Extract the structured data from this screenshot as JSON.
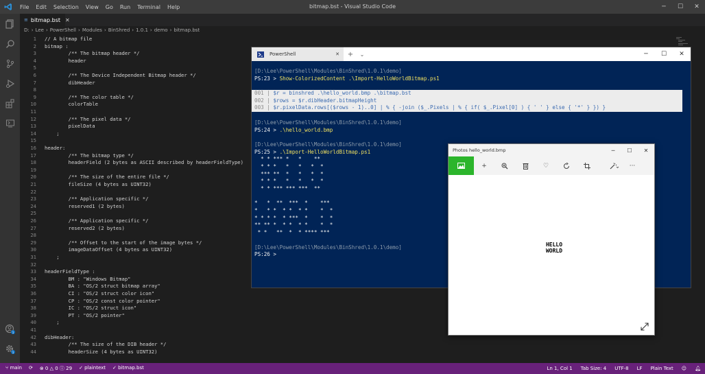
{
  "window": {
    "title": "bitmap.bst - Visual Studio Code"
  },
  "menu": [
    "File",
    "Edit",
    "Selection",
    "View",
    "Go",
    "Run",
    "Terminal",
    "Help"
  ],
  "tab": {
    "label": "bitmap.bst"
  },
  "breadcrumb": [
    "D:",
    "Lee",
    "PowerShell",
    "Modules",
    "BinShred",
    "1.0.1",
    "demo",
    "bitmap.bst"
  ],
  "code_lines": [
    {
      "n": "1",
      "t": "// A bitmap file"
    },
    {
      "n": "2",
      "t": "bitmap :"
    },
    {
      "n": "3",
      "t": "        /** The bitmap header */"
    },
    {
      "n": "4",
      "t": "        header"
    },
    {
      "n": "5",
      "t": ""
    },
    {
      "n": "6",
      "t": "        /** The Device Independent Bitmap header */"
    },
    {
      "n": "7",
      "t": "        dibHeader"
    },
    {
      "n": "8",
      "t": ""
    },
    {
      "n": "9",
      "t": "        /** The color table */"
    },
    {
      "n": "10",
      "t": "        colorTable"
    },
    {
      "n": "11",
      "t": ""
    },
    {
      "n": "12",
      "t": "        /** The pixel data */"
    },
    {
      "n": "13",
      "t": "        pixelData"
    },
    {
      "n": "14",
      "t": "    ;"
    },
    {
      "n": "15",
      "t": ""
    },
    {
      "n": "16",
      "t": "header:"
    },
    {
      "n": "17",
      "t": "        /** The bitmap type */"
    },
    {
      "n": "18",
      "t": "        headerField (2 bytes as ASCII described by headerFieldType)"
    },
    {
      "n": "19",
      "t": ""
    },
    {
      "n": "20",
      "t": "        /** The size of the entire file */"
    },
    {
      "n": "21",
      "t": "        fileSize (4 bytes as UINT32)"
    },
    {
      "n": "22",
      "t": ""
    },
    {
      "n": "23",
      "t": "        /** Application specific */"
    },
    {
      "n": "24",
      "t": "        reserved1 (2 bytes)"
    },
    {
      "n": "25",
      "t": ""
    },
    {
      "n": "26",
      "t": "        /** Application specific */"
    },
    {
      "n": "27",
      "t": "        reserved2 (2 bytes)"
    },
    {
      "n": "28",
      "t": ""
    },
    {
      "n": "29",
      "t": "        /** Offset to the start of the image bytes */"
    },
    {
      "n": "30",
      "t": "        imageDataOffset (4 bytes as UINT32)"
    },
    {
      "n": "31",
      "t": "    ;"
    },
    {
      "n": "32",
      "t": ""
    },
    {
      "n": "33",
      "t": "headerFieldType :"
    },
    {
      "n": "34",
      "t": "        BM : \"Windows Bitmap\""
    },
    {
      "n": "35",
      "t": "        BA : \"OS/2 struct bitmap array\""
    },
    {
      "n": "36",
      "t": "        CI : \"OS/2 struct color icon\""
    },
    {
      "n": "37",
      "t": "        CP : \"OS/2 const color pointer\""
    },
    {
      "n": "38",
      "t": "        IC : \"OS/2 struct icon\""
    },
    {
      "n": "39",
      "t": "        PT : \"OS/2 pointer\""
    },
    {
      "n": "40",
      "t": "    ;"
    },
    {
      "n": "41",
      "t": ""
    },
    {
      "n": "42",
      "t": "dibHeader:"
    },
    {
      "n": "43",
      "t": "        /** The size of the DIB header */"
    },
    {
      "n": "44",
      "t": "        headerSize (4 bytes as UINT32)"
    }
  ],
  "powershell": {
    "tab_label": "PowerShell",
    "lines": [
      {
        "c": "gray",
        "t": "[D:\\Lee\\PowerShell\\Modules\\BinShred\\1.0.1\\demo]"
      },
      {
        "c": "prompt",
        "t": "PS:23 > ",
        "cmd": "Show-ColorizedContent .\\Import-HelloWorldBitmap.ps1"
      },
      {
        "c": "blank",
        "t": ""
      },
      {
        "c": "hl",
        "n": "001 | ",
        "t": "$r = binshred .\\hello_world.bmp .\\bitmap.bst"
      },
      {
        "c": "hl",
        "n": "002 | ",
        "t": "$rows = $r.dibHeader.bitmapHeight"
      },
      {
        "c": "hl",
        "n": "003 | ",
        "t": "$r.pixelData.rows[($rows - 1)..0] | % { -join ($_.Pixels | % { if( $_.Pixel[0] ) { ' ' } else { '*' } }) }"
      },
      {
        "c": "blank",
        "t": ""
      },
      {
        "c": "gray",
        "t": "[D:\\Lee\\PowerShell\\Modules\\BinShred\\1.0.1\\demo]"
      },
      {
        "c": "prompt",
        "t": "PS:24 > ",
        "cmd": ".\\hello_world.bmp"
      },
      {
        "c": "blank",
        "t": ""
      },
      {
        "c": "gray",
        "t": "[D:\\Lee\\PowerShell\\Modules\\BinShred\\1.0.1\\demo]"
      },
      {
        "c": "prompt",
        "t": "PS:25 > ",
        "cmd": ".\\Import-HelloWorldBitmap.ps1"
      },
      {
        "c": "out",
        "t": "  * * *** *   *    **"
      },
      {
        "c": "out",
        "t": "  * * *   *   *   *  *"
      },
      {
        "c": "out",
        "t": "  *** **  *   *   *  *"
      },
      {
        "c": "out",
        "t": "  * * *   *   *   *  *"
      },
      {
        "c": "out",
        "t": "  * * *** *** ***  **"
      },
      {
        "c": "blank",
        "t": ""
      },
      {
        "c": "out",
        "t": "*   *  **  ***  *    ***"
      },
      {
        "c": "out",
        "t": "*   * *  * *  * *    *  *"
      },
      {
        "c": "out",
        "t": "* * * *  * ***  *    *  *"
      },
      {
        "c": "out",
        "t": "** ** *  * *  * *    *  *"
      },
      {
        "c": "out",
        "t": " * *   **  *  * **** ***"
      },
      {
        "c": "blank",
        "t": ""
      },
      {
        "c": "gray",
        "t": "[D:\\Lee\\PowerShell\\Modules\\BinShred\\1.0.1\\demo]"
      },
      {
        "c": "prompt",
        "t": "PS:26 > ",
        "cmd": ""
      }
    ]
  },
  "photos": {
    "title": "Photos  hello_world.bmp",
    "image_text": [
      "HELLO",
      "WORLD"
    ]
  },
  "status": {
    "branch": "main",
    "problems": "0",
    "warnings": "0",
    "info": "29",
    "item1": "plaintext",
    "item2": "bitmap.bst",
    "position": "Ln 1, Col 1",
    "tab_size": "Tab Size: 4",
    "encoding": "UTF-8",
    "eol": "LF",
    "language": "Plain Text"
  }
}
